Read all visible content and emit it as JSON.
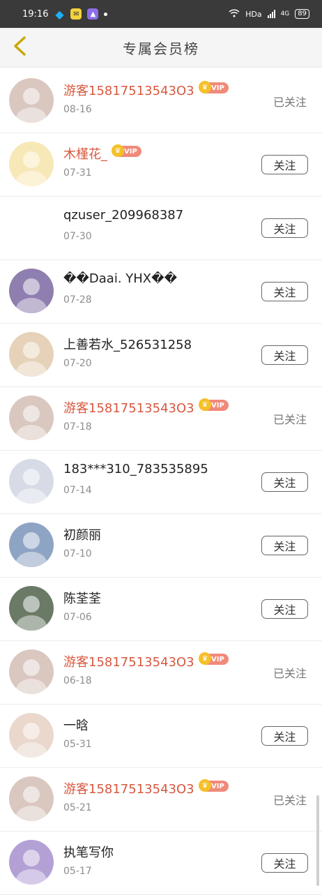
{
  "status_bar": {
    "time": "19:16",
    "network": "HDa",
    "signal": "4G",
    "battery": "89"
  },
  "header": {
    "title": "专属会员榜"
  },
  "users": [
    {
      "name": "游客15817513543O3",
      "date": "08-16",
      "vip": true,
      "vip_label": "VIP",
      "followed": true,
      "follow_label": "已关注",
      "avatar_color": "#d9c7c0"
    },
    {
      "name": "木槿花_",
      "date": "07-31",
      "vip": true,
      "vip_label": "VIP",
      "followed": false,
      "follow_label": "关注",
      "avatar_color": "#f7e8b7"
    },
    {
      "name": "qzuser_209968387",
      "date": "07-30",
      "vip": false,
      "followed": false,
      "follow_label": "关注",
      "avatar_color": "#ffffff"
    },
    {
      "name": "��Daai. YHX��",
      "date": "07-28",
      "vip": false,
      "followed": false,
      "follow_label": "关注",
      "avatar_color": "#8f7fb0"
    },
    {
      "name": "上善若水_526531258",
      "date": "07-20",
      "vip": false,
      "followed": false,
      "follow_label": "关注",
      "avatar_color": "#e6d2b8"
    },
    {
      "name": "游客15817513543O3",
      "date": "07-18",
      "vip": true,
      "vip_label": "VIP",
      "followed": true,
      "follow_label": "已关注",
      "avatar_color": "#d9c7c0"
    },
    {
      "name": "183***310_783535895",
      "date": "07-14",
      "vip": false,
      "followed": false,
      "follow_label": "关注",
      "avatar_color": "#d6dbe6"
    },
    {
      "name": "初颜丽",
      "date": "07-10",
      "vip": false,
      "followed": false,
      "follow_label": "关注",
      "avatar_color": "#8ea4c4"
    },
    {
      "name": "陈荃荃",
      "date": "07-06",
      "vip": false,
      "followed": false,
      "follow_label": "关注",
      "avatar_color": "#6a7a66"
    },
    {
      "name": "游客15817513543O3",
      "date": "06-18",
      "vip": true,
      "vip_label": "VIP",
      "followed": true,
      "follow_label": "已关注",
      "avatar_color": "#d9c7c0"
    },
    {
      "name": "一晗",
      "date": "05-31",
      "vip": false,
      "followed": false,
      "follow_label": "关注",
      "avatar_color": "#ead8cd"
    },
    {
      "name": "游客15817513543O3",
      "date": "05-21",
      "vip": true,
      "vip_label": "VIP",
      "followed": true,
      "follow_label": "已关注",
      "avatar_color": "#d9c7c0"
    },
    {
      "name": "执笔写你",
      "date": "05-17",
      "vip": false,
      "followed": false,
      "follow_label": "关注",
      "avatar_color": "#b3a1d6"
    }
  ]
}
